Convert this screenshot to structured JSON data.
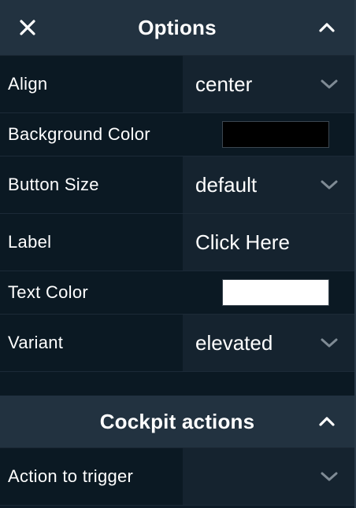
{
  "options_panel": {
    "title": "Options",
    "close_icon": "close-x-icon",
    "collapse_icon": "chevron-up-icon",
    "rows": [
      {
        "label": "Align",
        "type": "select",
        "value": "center"
      },
      {
        "label": "Background Color",
        "type": "color",
        "color": "#000000"
      },
      {
        "label": "Button Size",
        "type": "select",
        "value": "default"
      },
      {
        "label": "Label",
        "type": "text",
        "value": "Click Here"
      },
      {
        "label": "Text Color",
        "type": "color",
        "color": "#ffffff"
      },
      {
        "label": "Variant",
        "type": "select",
        "value": "elevated"
      }
    ]
  },
  "cockpit_actions": {
    "title": "Cockpit actions",
    "collapse_icon": "chevron-up-icon",
    "rows": [
      {
        "label": "Action to trigger",
        "type": "select",
        "value": ""
      }
    ]
  },
  "colors": {
    "header_bg": "#223240",
    "panel_bg": "#0b1923",
    "field_bg": "#15232f",
    "chevron": "#7f8b95"
  }
}
